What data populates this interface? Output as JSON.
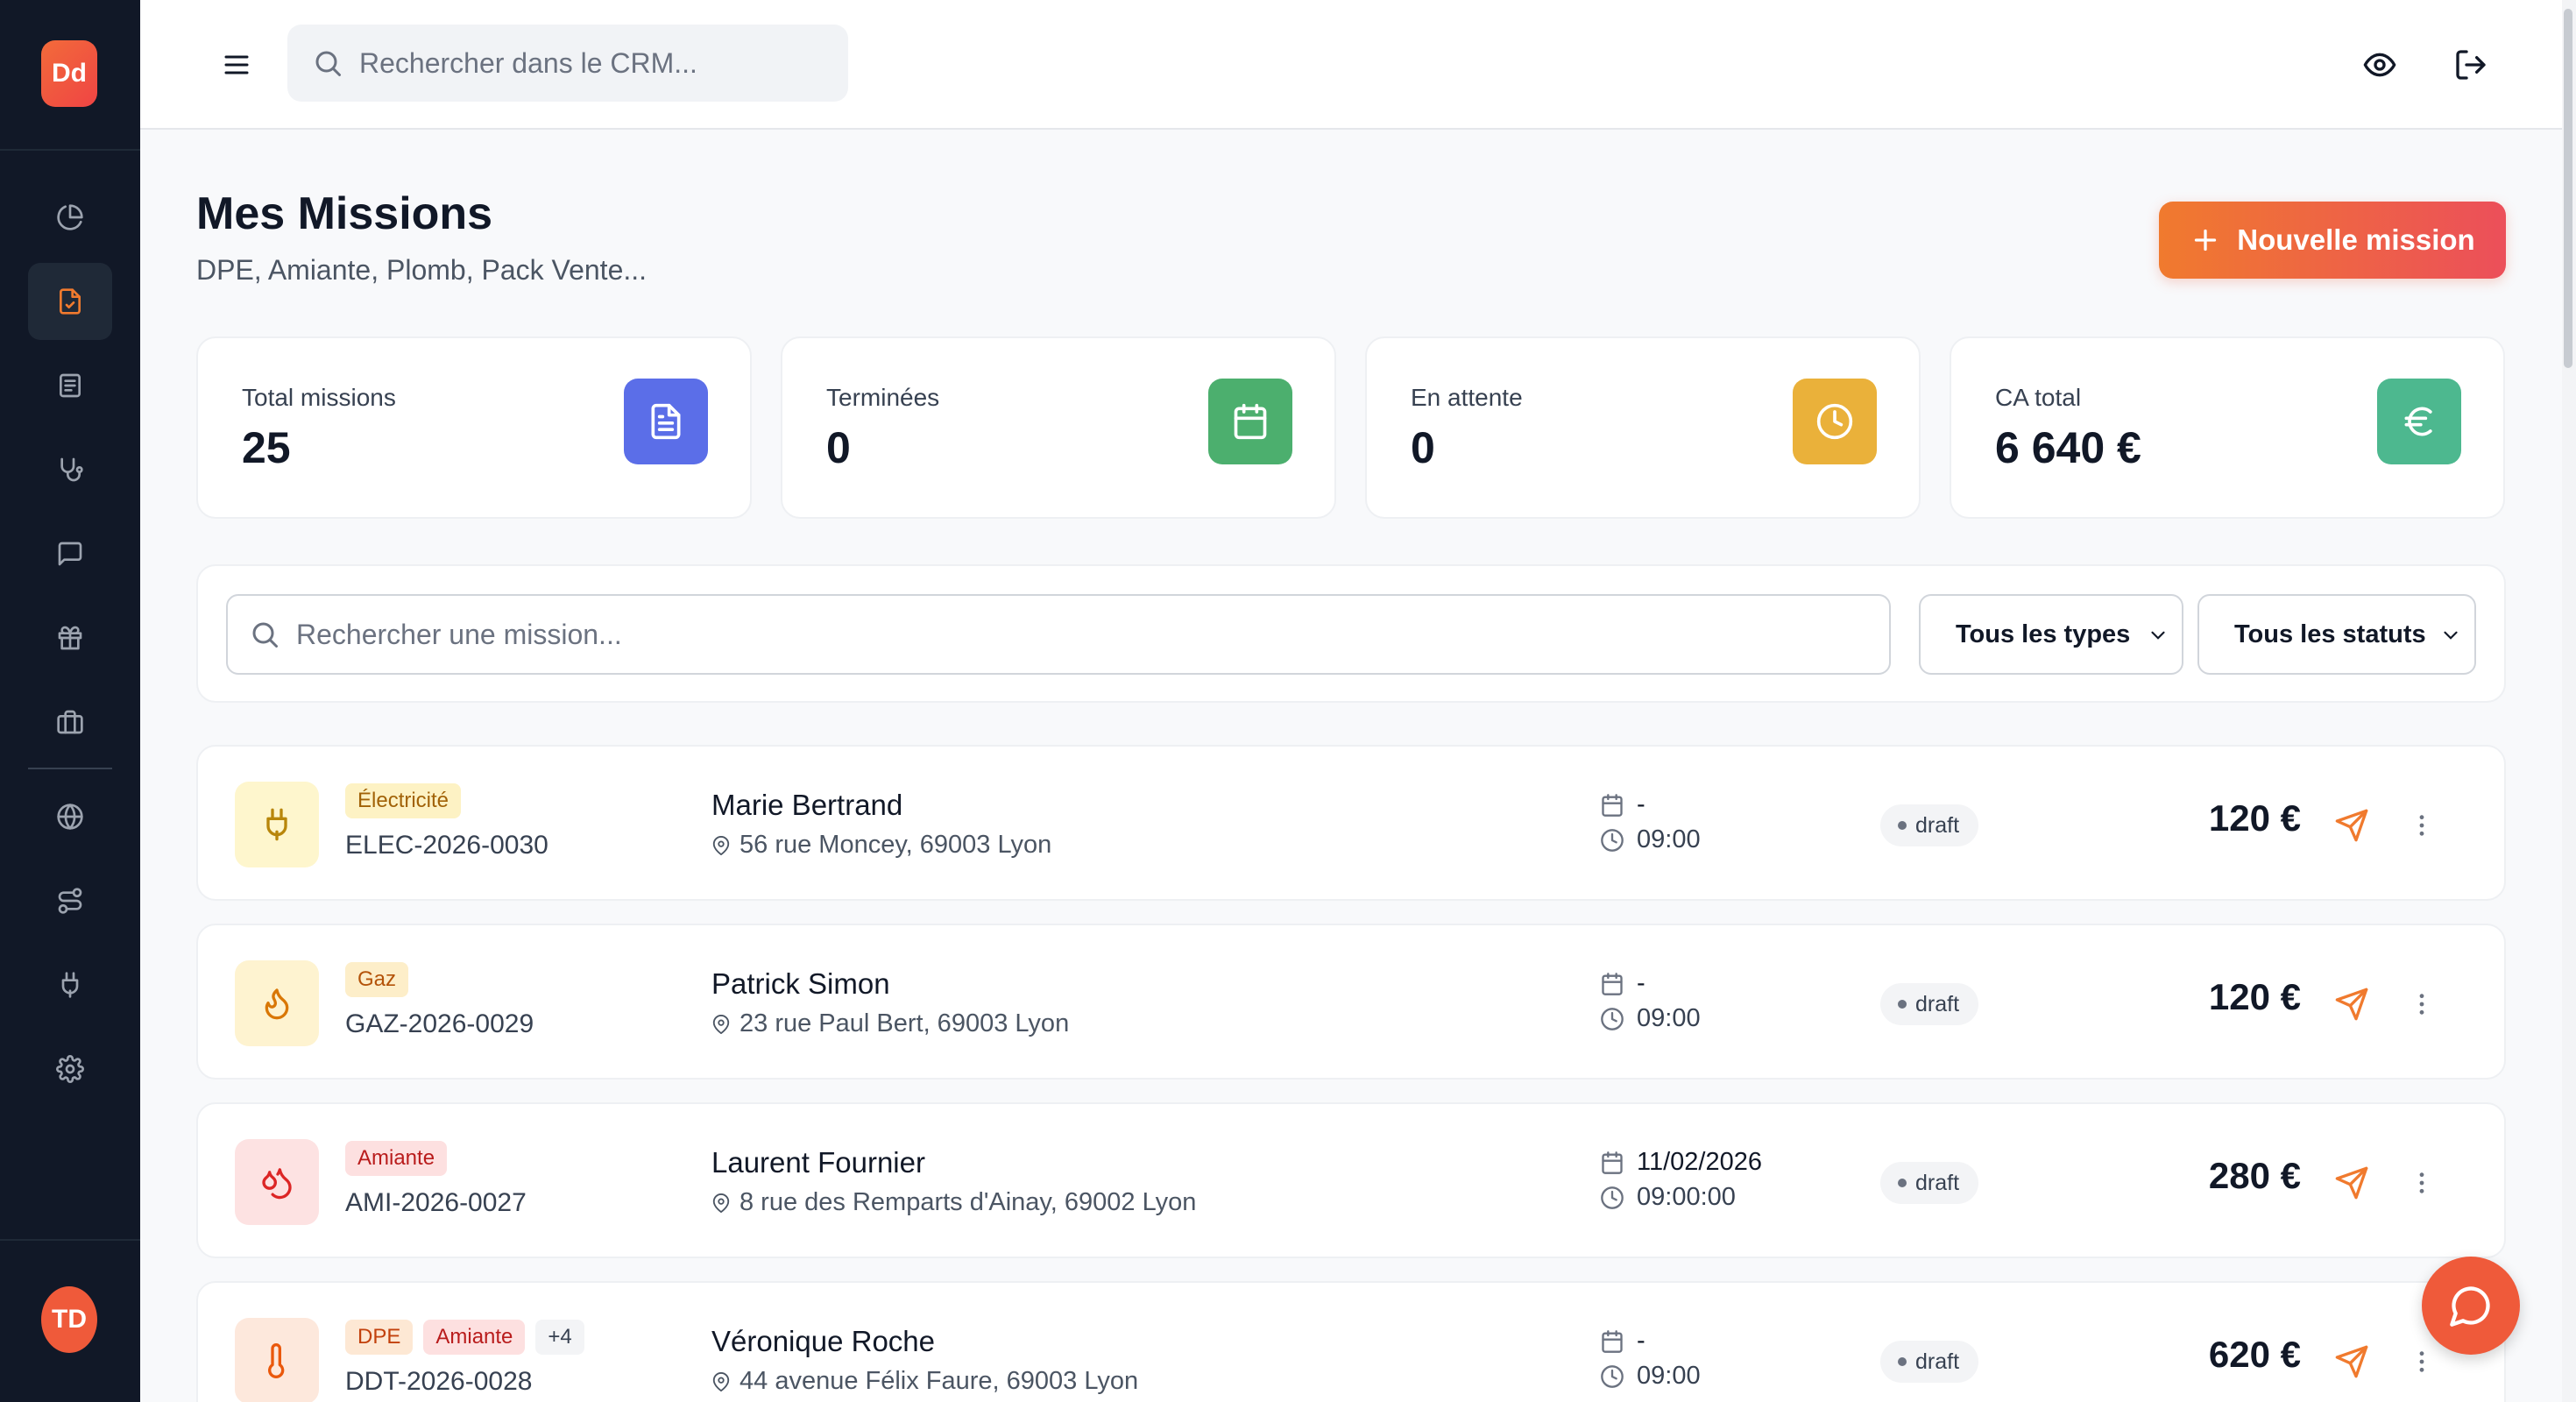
{
  "app": {
    "logo_text": "Dd",
    "user_initials": "TD"
  },
  "sidebar": {
    "items": [
      {
        "name": "dashboard-icon",
        "active": false
      },
      {
        "name": "missions-icon",
        "active": true
      },
      {
        "name": "documents-icon",
        "active": false
      },
      {
        "name": "stethoscope-icon",
        "active": false
      },
      {
        "name": "messages-icon",
        "active": false
      },
      {
        "name": "gift-icon",
        "active": false
      },
      {
        "name": "briefcase-icon",
        "active": false
      },
      {
        "name": "globe-icon",
        "active": false
      },
      {
        "name": "route-icon",
        "active": false
      },
      {
        "name": "plug-icon",
        "active": false
      },
      {
        "name": "settings-icon",
        "active": false
      }
    ]
  },
  "topbar": {
    "search_placeholder": "Rechercher dans le CRM..."
  },
  "header": {
    "title": "Mes Missions",
    "subtitle": "DPE, Amiante, Plomb, Pack Vente...",
    "new_button": "Nouvelle mission"
  },
  "stats": [
    {
      "label": "Total missions",
      "value": "25",
      "color": "#5b6ee8"
    },
    {
      "label": "Terminées",
      "value": "0",
      "color": "#4caf6e"
    },
    {
      "label": "En attente",
      "value": "0",
      "color": "#eab13a"
    },
    {
      "label": "CA total",
      "value": "6 640 €",
      "color": "#4db88f"
    }
  ],
  "filters": {
    "search_placeholder": "Rechercher une mission...",
    "type_select": "Tous les types",
    "status_select": "Tous les statuts"
  },
  "missions": [
    {
      "tags": [
        "Électricité"
      ],
      "ref": "ELEC-2026-0030",
      "client": "Marie Bertrand",
      "address": "56 rue Moncey, 69003 Lyon",
      "date": "-",
      "time": "09:00",
      "status": "draft",
      "price": "120 €"
    },
    {
      "tags": [
        "Gaz"
      ],
      "ref": "GAZ-2026-0029",
      "client": "Patrick Simon",
      "address": "23 rue Paul Bert, 69003 Lyon",
      "date": "-",
      "time": "09:00",
      "status": "draft",
      "price": "120 €"
    },
    {
      "tags": [
        "Amiante"
      ],
      "ref": "AMI-2026-0027",
      "client": "Laurent Fournier",
      "address": "8 rue des Remparts d'Ainay, 69002 Lyon",
      "date": "11/02/2026",
      "time": "09:00:00",
      "status": "draft",
      "price": "280 €"
    },
    {
      "tags": [
        "DPE",
        "Amiante",
        "+4"
      ],
      "ref": "DDT-2026-0028",
      "client": "Véronique Roche",
      "address": "44 avenue Félix Faure, 69003 Lyon",
      "date": "-",
      "time": "09:00",
      "status": "draft",
      "price": "620 €"
    }
  ],
  "colors": {
    "accent": "#ef5a3a",
    "sidebar": "#111827"
  }
}
